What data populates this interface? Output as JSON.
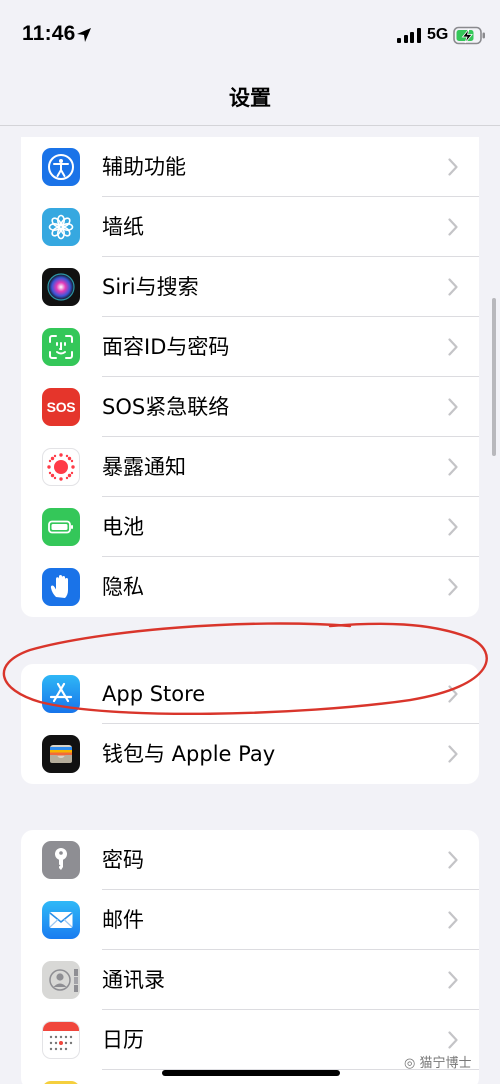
{
  "status_bar": {
    "time": "11:46",
    "network": "5G"
  },
  "nav": {
    "title": "设置"
  },
  "groups": [
    {
      "rows": [
        {
          "label": "辅助功能",
          "icon": "accessibility-icon",
          "color": "#1a73e8"
        },
        {
          "label": "墙纸",
          "icon": "wallpaper-flower-icon",
          "color": "#36a8e0"
        },
        {
          "label": "Siri与搜索",
          "icon": "siri-icon",
          "color": "#111111"
        },
        {
          "label": "面容ID与密码",
          "icon": "face-id-icon",
          "color": "#34c759"
        },
        {
          "label": "SOS紧急联络",
          "icon": "sos-icon",
          "color": "#e5352b",
          "icon_text": "SOS"
        },
        {
          "label": "暴露通知",
          "icon": "exposure-notification-icon",
          "color": "#ffffff"
        },
        {
          "label": "电池",
          "icon": "battery-icon",
          "color": "#34c759"
        },
        {
          "label": "隐私",
          "icon": "hand-icon",
          "color": "#1a73e8"
        }
      ]
    },
    {
      "rows": [
        {
          "label": "App Store",
          "icon": "app-store-icon",
          "color": "#1a8cf0"
        },
        {
          "label": "钱包与 Apple Pay",
          "icon": "wallet-icon",
          "color": "#111111"
        }
      ]
    },
    {
      "rows": [
        {
          "label": "密码",
          "icon": "key-icon",
          "color": "#8e8e93"
        },
        {
          "label": "邮件",
          "icon": "mail-icon",
          "color": "#1a8cf0"
        },
        {
          "label": "通讯录",
          "icon": "contacts-icon",
          "color": "#d8d8d6"
        },
        {
          "label": "日历",
          "icon": "calendar-icon",
          "color": "#ffffff"
        }
      ]
    }
  ],
  "watermark": "猫宁博士"
}
